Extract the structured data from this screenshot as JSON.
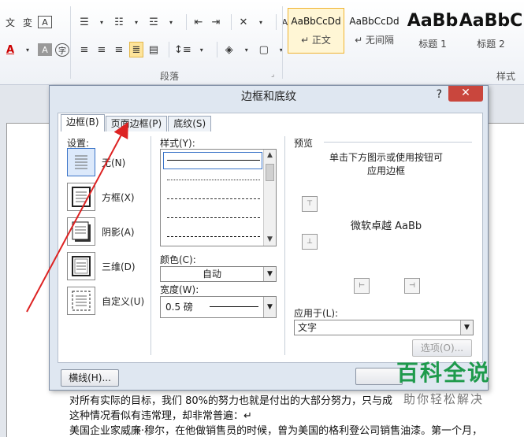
{
  "ribbon": {
    "paragraph_group_label": "段落",
    "styles_group_label": "样式",
    "styles": [
      {
        "sample": "AaBbCcDd",
        "name": "↵ 正文",
        "selected": true,
        "big": false
      },
      {
        "sample": "AaBbCcDd",
        "name": "↵ 无间隔",
        "selected": false,
        "big": false
      },
      {
        "sample": "AaBb",
        "name": "标题 1",
        "selected": false,
        "big": true
      },
      {
        "sample": "AaBbC",
        "name": "标题 2",
        "selected": false,
        "big": true
      }
    ],
    "font_color_label": "A",
    "char_shading_label": "A",
    "enclose_char_label": "字",
    "phonetic_label": "文",
    "char_border_label": "A"
  },
  "dialog": {
    "title": "边框和底纹",
    "help": "?",
    "close": "✕",
    "tabs": [
      "边框(B)",
      "页面边框(P)",
      "底纹(S)"
    ],
    "settings_label": "设置:",
    "settings": [
      "无(N)",
      "方框(X)",
      "阴影(A)",
      "三维(D)",
      "自定义(U)"
    ],
    "style_label": "样式(Y):",
    "color_label": "颜色(C):",
    "color_value": "自动",
    "width_label": "宽度(W):",
    "width_value": "0.5 磅",
    "preview_label": "预览",
    "preview_hint_1": "单击下方图示或使用按钮可",
    "preview_hint_2": "应用边框",
    "preview_sample": "微软卓越  AaBb",
    "apply_label": "应用于(L):",
    "apply_value": "文字",
    "options_button": "选项(O)...",
    "hline_button": "横线(H)..."
  },
  "document": {
    "lines": [
      "对所有实际的目标，我们 80%的努力也就是付出的大部分努力，只与成",
      "这种情况看似有违常理，却非常普遍：↵",
      "美国企业家威廉·穆尔，在他做销售员的时候，曾为美国的格利登公司销售油漆。第一个月，"
    ]
  },
  "watermark": {
    "main": "百科全说",
    "sub": "助你轻松解决"
  }
}
